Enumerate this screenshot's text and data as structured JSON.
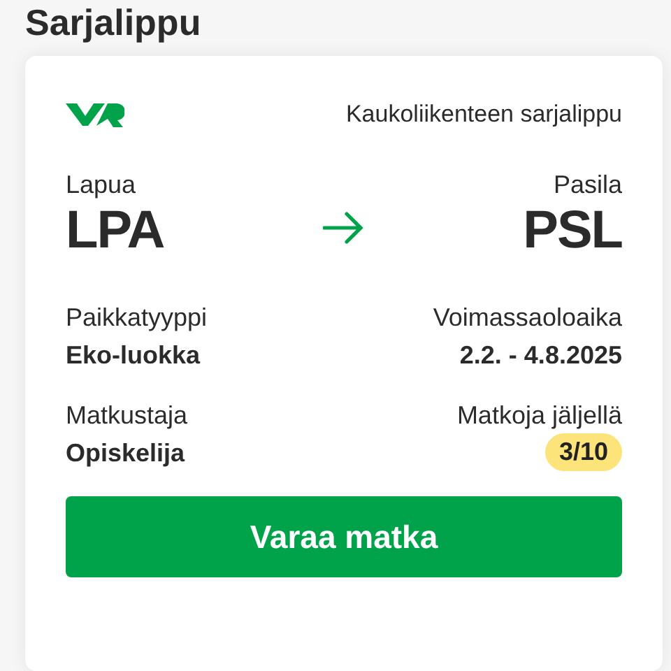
{
  "page_title": "Sarjalippu",
  "ticket": {
    "type": "Kaukoliikenteen sarjalippu",
    "from": {
      "name": "Lapua",
      "code": "LPA"
    },
    "to": {
      "name": "Pasila",
      "code": "PSL"
    },
    "details": [
      {
        "label": "Paikkatyyppi",
        "value": "Eko-luokka",
        "kind": "text"
      },
      {
        "label": "Voimassaoloaika",
        "value": "2.2. - 4.8.2025",
        "kind": "text"
      },
      {
        "label": "Matkustaja",
        "value": "Opiskelija",
        "kind": "text"
      },
      {
        "label": "Matkoja jäljellä",
        "value": "3/10",
        "kind": "badge"
      }
    ],
    "button": "Varaa matka"
  }
}
